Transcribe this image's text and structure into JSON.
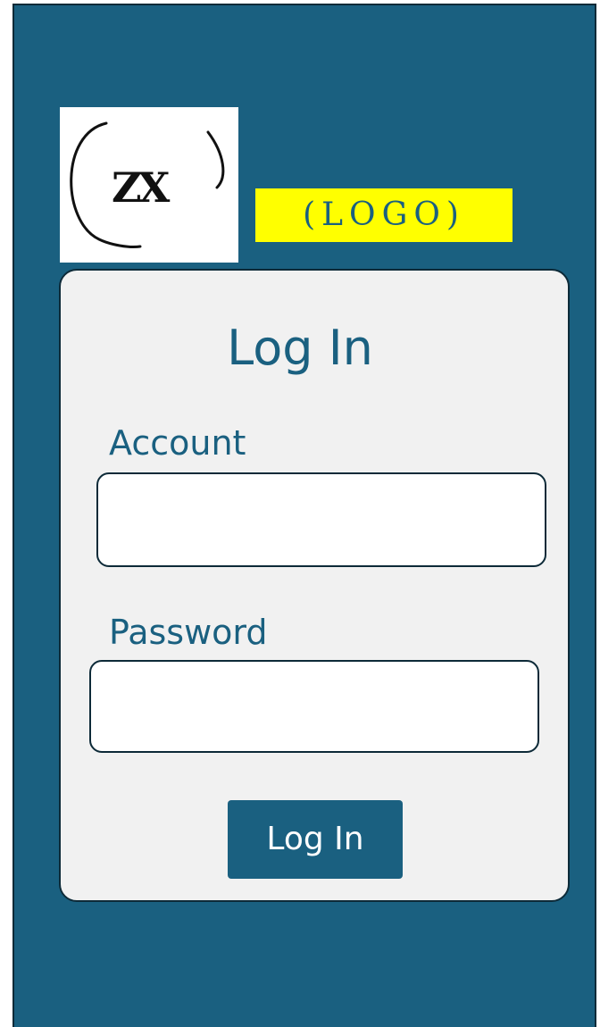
{
  "logo": {
    "mark_text": "ZX",
    "tag": "(LOGO)"
  },
  "login": {
    "title": "Log In",
    "account_label": "Account",
    "account_value": "",
    "password_label": "Password",
    "password_value": "",
    "submit_label": "Log In"
  },
  "colors": {
    "background": "#1a6080",
    "card": "#f1f1f1",
    "border": "#0d2a38",
    "logo_tag_highlight": "#ffff00",
    "text": "#1a6080"
  }
}
